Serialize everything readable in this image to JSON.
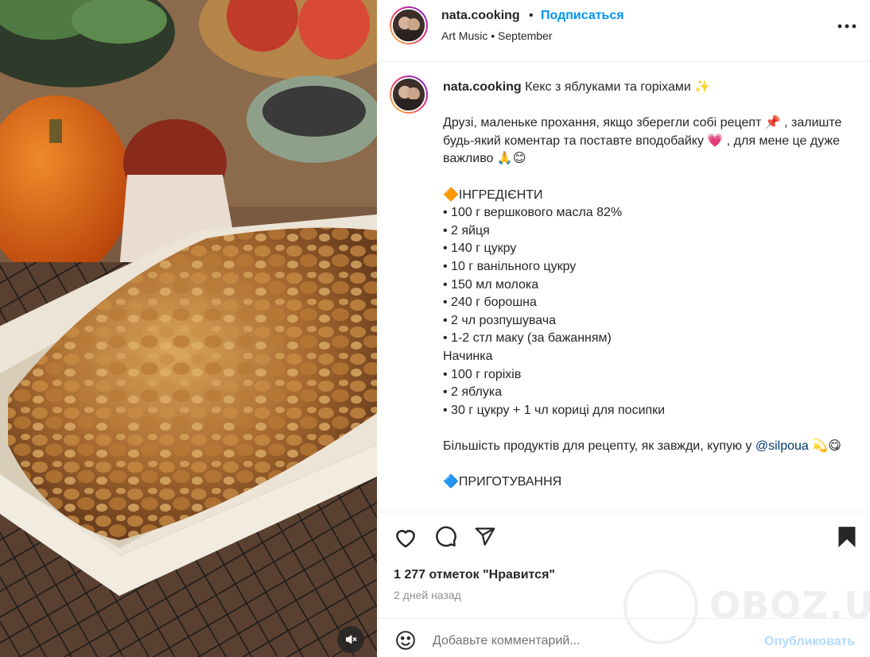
{
  "post": {
    "username": "nata.cooking",
    "separator": "•",
    "follow_label": "Подписаться",
    "audio": "Art Music",
    "audio_separator": "•",
    "audio_date": "September"
  },
  "caption": {
    "username": "nata.cooking",
    "title": "Кекс з яблуками та горіхами ✨",
    "para1": "Друзі, маленьке прохання, якщо зберегли собі рецепт 📌 , залиште будь-який коментар та поставте вподобайку 💗 , для мене це дуже важливо 🙏😊",
    "section1": "🔶ІНГРЕДІЄНТИ",
    "ingredients": [
      "• 100 г вершкового масла 82%",
      "• 2 яйця",
      "• 140 г цукру",
      "• 10 г ванільного цукру",
      "• 150 мл молока",
      "• 240 г борошна",
      "• 2 чл розпушувача",
      "• 1-2 стл маку (за бажанням)"
    ],
    "filling_title": "Начинка",
    "filling": [
      "• 100 г горіхів",
      "• 2 яблука",
      "• 30 г цукру + 1 чл кориці для посипки"
    ],
    "para2_prefix": "Більшість продуктів для рецепту, як завжди, купую у ",
    "para2_mention": "@silpoua",
    "para2_suffix": " 💫😋",
    "section2": "🔷ПРИГОТУВАННЯ"
  },
  "engagement": {
    "likes_text": "1 277 отметок \"Нравится\"",
    "date_text": "2 дней назад"
  },
  "comment": {
    "placeholder": "Добавьте комментарий...",
    "publish_label": "Опубликовать"
  },
  "watermark": {
    "text": "OBOZ.UA"
  },
  "icons": {
    "like": "heart-icon",
    "comment": "comment-bubble-icon",
    "share": "paper-plane-icon",
    "save": "bookmark-filled-icon",
    "more": "more-horizontal-icon",
    "emoji": "smiley-icon",
    "mute": "speaker-muted-icon"
  },
  "colors": {
    "link_blue": "#0095f6",
    "publish_disabled": "#b3dbff",
    "mention": "#00376b",
    "muted_text": "#8e8e8e"
  }
}
